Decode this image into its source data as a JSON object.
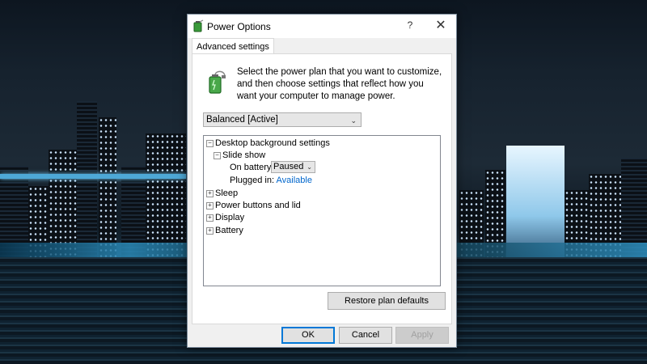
{
  "window": {
    "title": "Power Options",
    "help_label": "?",
    "close_label": "✕"
  },
  "tab": {
    "label": "Advanced settings"
  },
  "description": "Select the power plan that you want to customize, and then choose settings that reflect how you want your computer to manage power.",
  "plan_select": {
    "value": "Balanced [Active]"
  },
  "tree": {
    "desktop_background": {
      "label": "Desktop background settings",
      "expanded": true
    },
    "slide_show": {
      "label": "Slide show",
      "expanded": true
    },
    "on_battery": {
      "label": "On battery:",
      "value": "Paused"
    },
    "plugged_in": {
      "label": "Plugged in:",
      "value": "Available"
    },
    "sleep": {
      "label": "Sleep"
    },
    "power_buttons": {
      "label": "Power buttons and lid"
    },
    "display": {
      "label": "Display"
    },
    "battery": {
      "label": "Battery"
    }
  },
  "buttons": {
    "restore": "Restore plan defaults",
    "ok": "OK",
    "cancel": "Cancel",
    "apply": "Apply"
  },
  "icons": {
    "app": "power-options-icon",
    "battery": "battery-plug-icon",
    "expand": "plus-box-icon",
    "collapse": "minus-box-icon",
    "dropdown": "chevron-down-icon"
  },
  "colors": {
    "accent": "#0078d7",
    "link": "#0066cc"
  }
}
